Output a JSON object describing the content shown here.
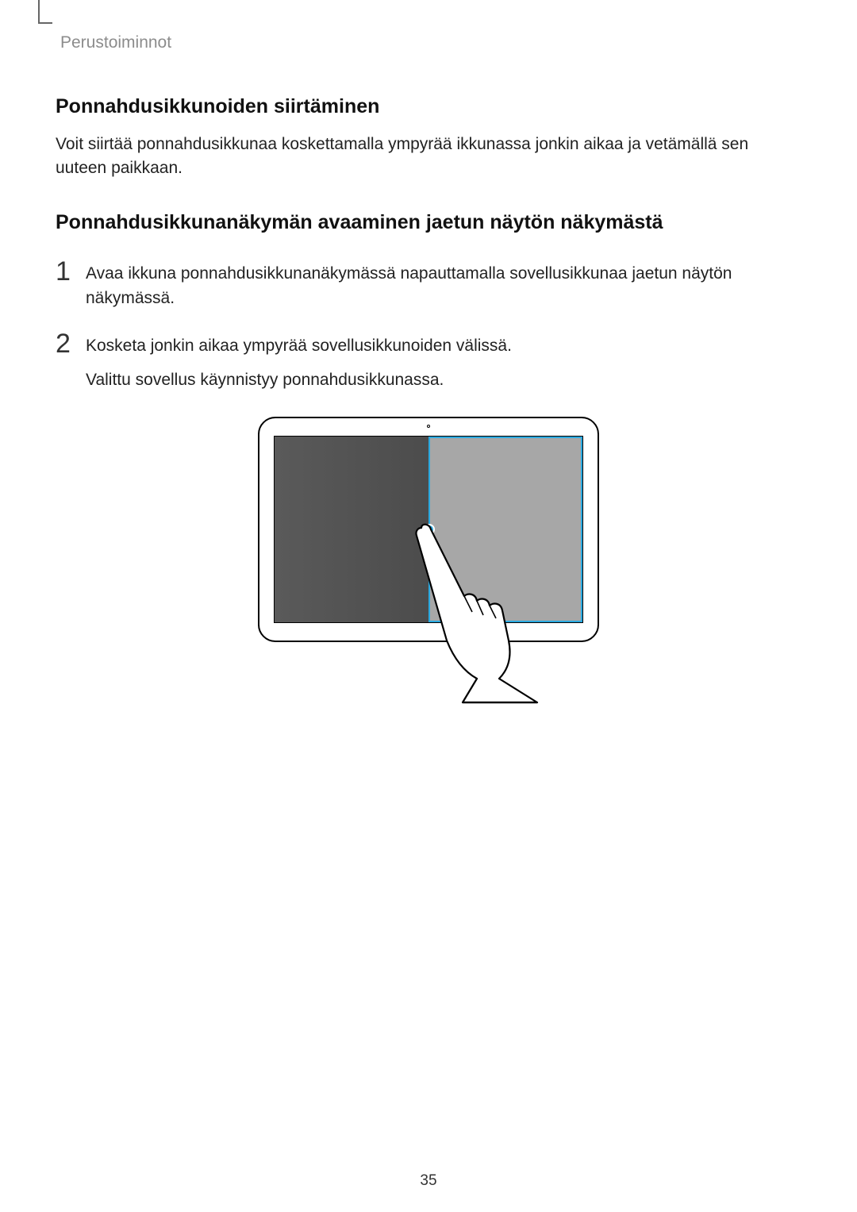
{
  "header": {
    "section": "Perustoiminnot"
  },
  "sections": {
    "s1": {
      "title": "Ponnahdusikkunoiden siirtäminen",
      "body": "Voit siirtää ponnahdusikkunaa koskettamalla ympyrää ikkunassa jonkin aikaa ja vetämällä sen uuteen paikkaan."
    },
    "s2": {
      "title": "Ponnahdusikkunanäkymän avaaminen jaetun näytön näkymästä",
      "steps": [
        {
          "num": "1",
          "text": "Avaa ikkuna ponnahdusikkunanäkymässä napauttamalla sovellusikkunaa jaetun näytön näkymässä."
        },
        {
          "num": "2",
          "text": "Kosketa jonkin aikaa ympyrää sovellusikkunoiden välissä.",
          "text2": "Valittu sovellus käynnistyy ponnahdusikkunassa."
        }
      ]
    }
  },
  "page_number": "35"
}
